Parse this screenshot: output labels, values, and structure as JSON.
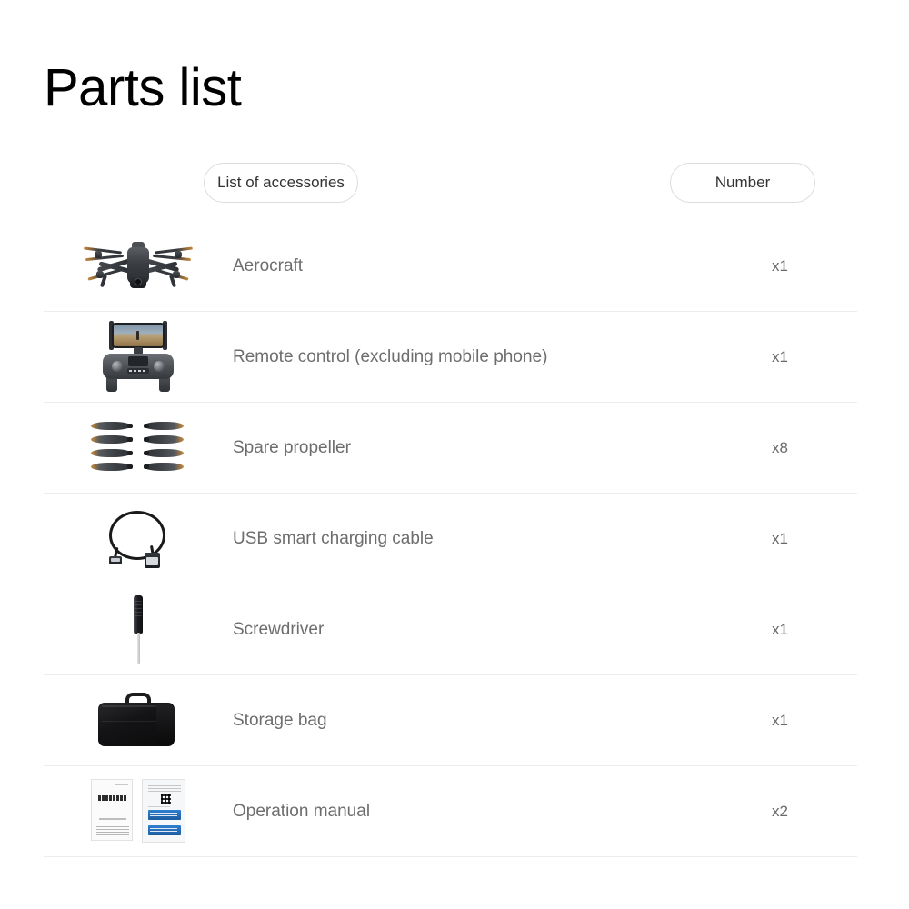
{
  "page": {
    "title": "Parts list",
    "background_color": "#ffffff",
    "title_color": "#000000",
    "label_color": "#6d6d6d",
    "divider_color": "#ececec"
  },
  "table": {
    "headers": {
      "accessories": "List of accessories",
      "number": "Number"
    },
    "rows": [
      {
        "thumb": "drone-icon",
        "label": "Aerocraft",
        "qty": "x1"
      },
      {
        "thumb": "remote-control-icon",
        "label": "Remote control (excluding mobile phone)",
        "qty": "x1"
      },
      {
        "thumb": "propellers-icon",
        "label": "Spare propeller",
        "qty": "x8"
      },
      {
        "thumb": "usb-cable-icon",
        "label": "USB smart charging cable",
        "qty": "x1"
      },
      {
        "thumb": "screwdriver-icon",
        "label": "Screwdriver",
        "qty": "x1"
      },
      {
        "thumb": "storage-bag-icon",
        "label": "Storage bag",
        "qty": "x1"
      },
      {
        "thumb": "manual-icon",
        "label": "Operation manual",
        "qty": "x2"
      }
    ]
  }
}
